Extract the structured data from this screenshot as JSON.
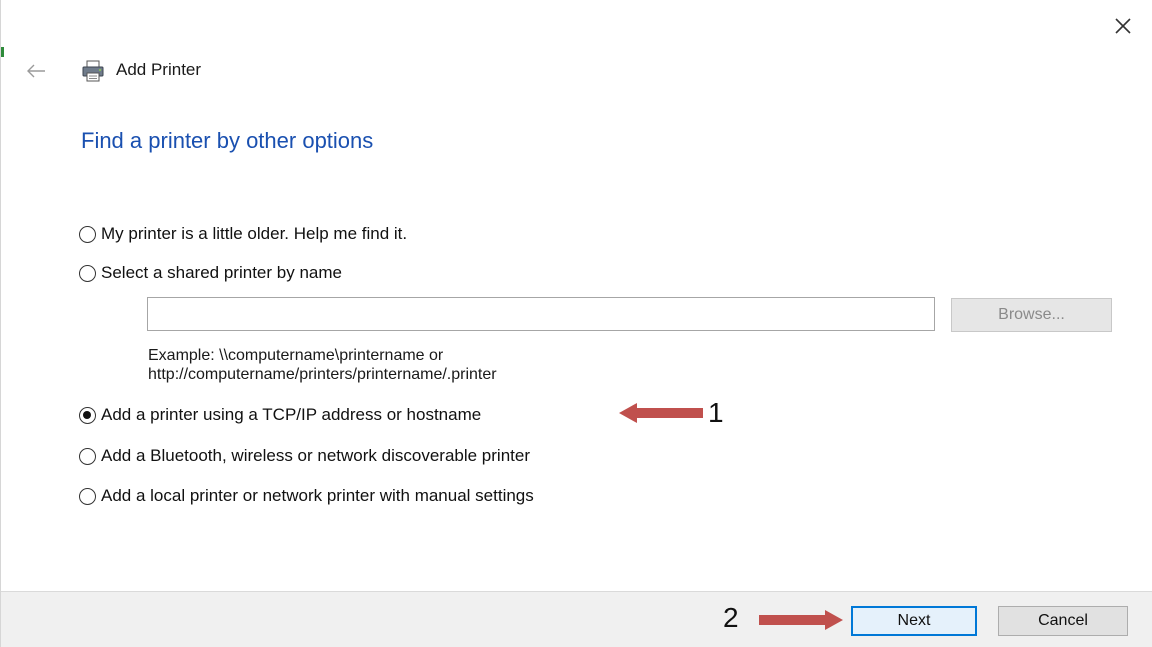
{
  "window": {
    "title": "Add Printer",
    "heading": "Find a printer by other options"
  },
  "options": [
    {
      "label": "My printer is a little older. Help me find it.",
      "checked": false
    },
    {
      "label": "Select a shared printer by name",
      "checked": false
    },
    {
      "label": "Add a printer using a TCP/IP address or hostname",
      "checked": true
    },
    {
      "label": "Add a Bluetooth, wireless or network discoverable printer",
      "checked": false
    },
    {
      "label": "Add a local printer or network printer with manual settings",
      "checked": false
    }
  ],
  "shared_printer": {
    "input_value": "",
    "browse_label": "Browse...",
    "example_line1": "Example: \\\\computername\\printername or",
    "example_line2": "http://computername/printers/printername/.printer"
  },
  "footer": {
    "next_label": "Next",
    "cancel_label": "Cancel"
  },
  "annotations": {
    "step1": "1",
    "step2": "2",
    "arrow_color": "#c0504d"
  },
  "icons": {
    "close": "close-icon",
    "back": "back-arrow-icon",
    "printer": "printer-icon"
  }
}
